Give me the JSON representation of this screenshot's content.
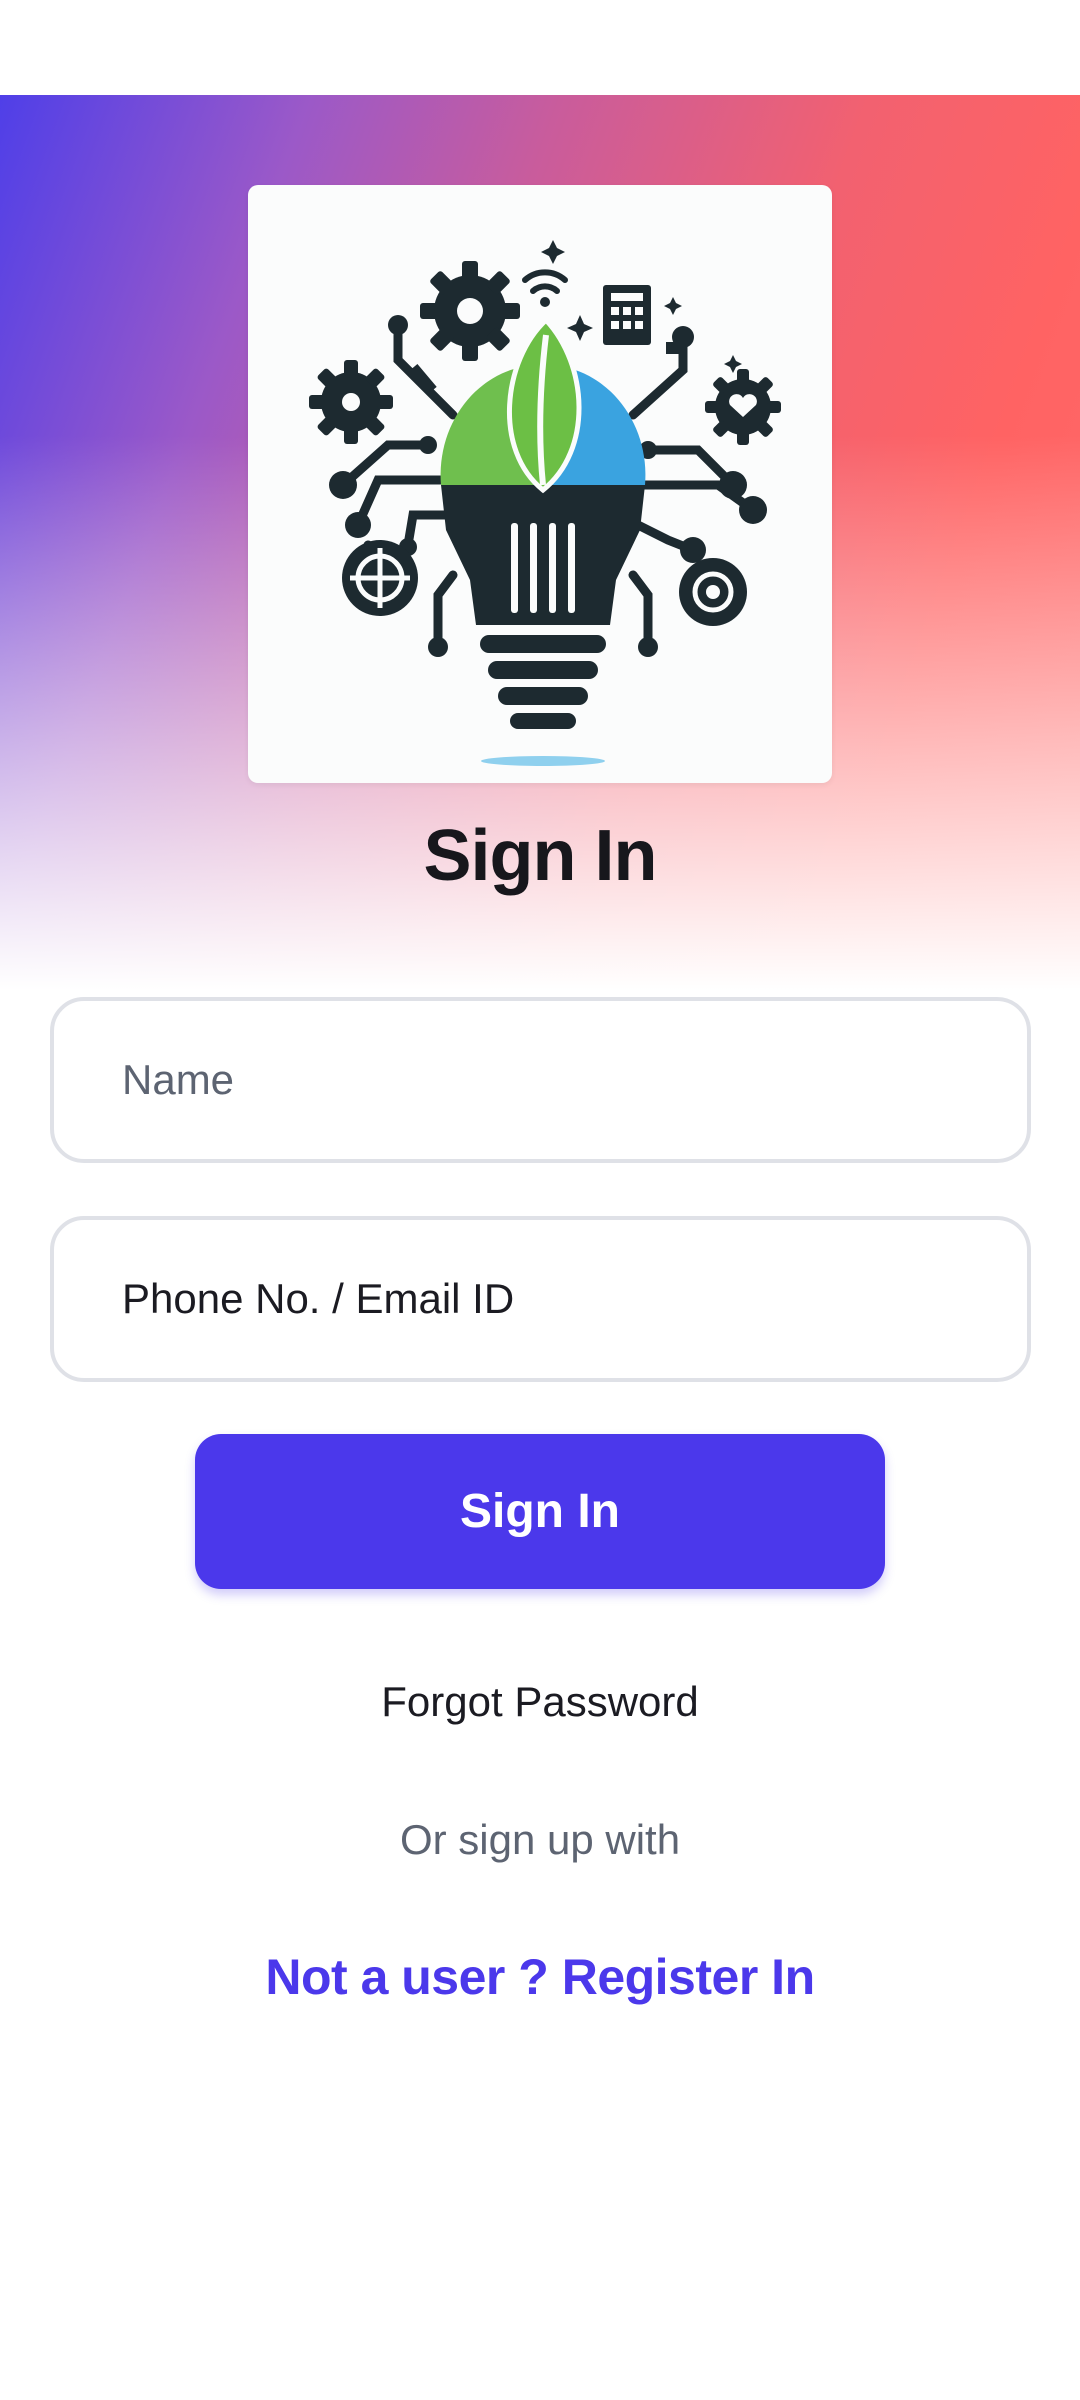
{
  "header": {
    "title": "Sign In"
  },
  "form": {
    "name_placeholder": "Name",
    "contact_placeholder": "Phone No. / Email ID",
    "submit_label": "Sign In"
  },
  "links": {
    "forgot_password": "Forgot Password",
    "alt_signup": "Or sign up with",
    "register": "Not a user ? Register In"
  },
  "logo": {
    "icon": "lightbulb-leaf-circuit-logo"
  },
  "colors": {
    "accent": "#4b38eb",
    "gradient_start": "#4f3fe8",
    "gradient_end": "#ff6363",
    "leaf_green": "#6cbf45",
    "bulb_blue": "#3aa3e0",
    "icon_dark": "#1d2a30"
  }
}
